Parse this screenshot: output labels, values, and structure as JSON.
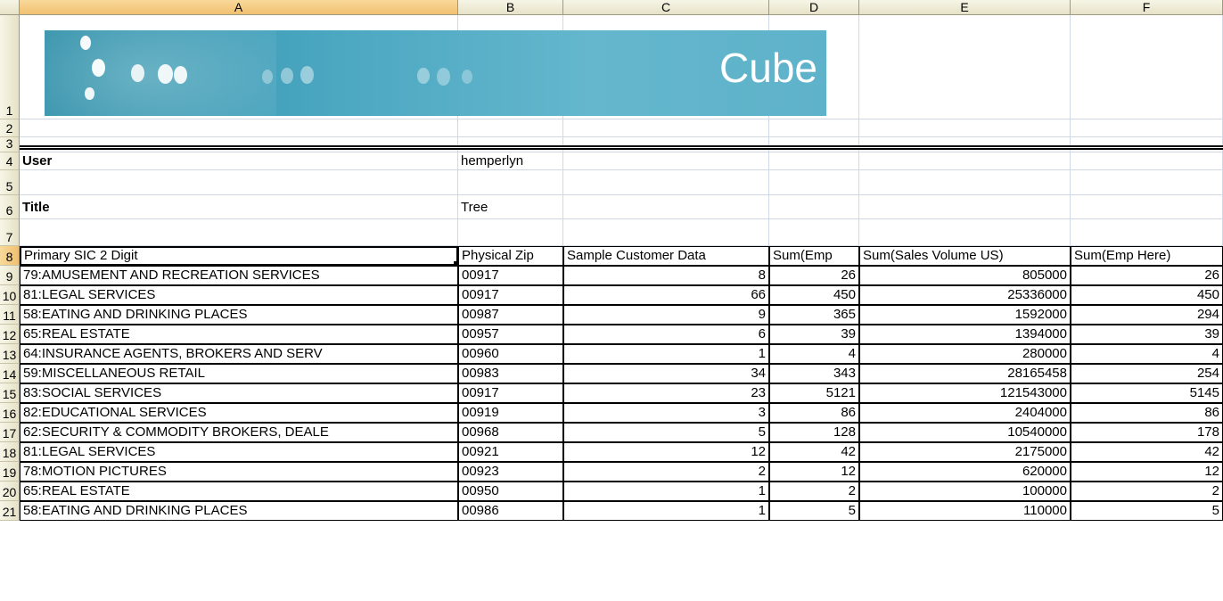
{
  "columns": [
    "A",
    "B",
    "C",
    "D",
    "E",
    "F"
  ],
  "row_numbers": [
    "1",
    "2",
    "3",
    "4",
    "5",
    "6",
    "7",
    "8",
    "9",
    "10",
    "11",
    "12",
    "13",
    "14",
    "15",
    "16",
    "17",
    "18",
    "19",
    "20",
    "21"
  ],
  "banner": {
    "title": "Cube"
  },
  "info": {
    "user_label": "User",
    "user_value": "hemperlyn",
    "title_label": "Title",
    "title_value": "Tree"
  },
  "table": {
    "headers": [
      "Primary SIC 2 Digit",
      "Physical Zip",
      "Sample Customer Data",
      "Sum(Emp",
      "Sum(Sales Volume US)",
      "Sum(Emp Here)"
    ],
    "rows": [
      [
        "79:AMUSEMENT AND RECREATION SERVICES",
        "00917",
        "8",
        "26",
        "805000",
        "26"
      ],
      [
        "81:LEGAL SERVICES",
        "00917",
        "66",
        "450",
        "25336000",
        "450"
      ],
      [
        "58:EATING AND DRINKING PLACES",
        "00987",
        "9",
        "365",
        "1592000",
        "294"
      ],
      [
        "65:REAL ESTATE",
        "00957",
        "6",
        "39",
        "1394000",
        "39"
      ],
      [
        "64:INSURANCE AGENTS, BROKERS AND SERV",
        "00960",
        "1",
        "4",
        "280000",
        "4"
      ],
      [
        "59:MISCELLANEOUS RETAIL",
        "00983",
        "34",
        "343",
        "28165458",
        "254"
      ],
      [
        "83:SOCIAL SERVICES",
        "00917",
        "23",
        "5121",
        "121543000",
        "5145"
      ],
      [
        "82:EDUCATIONAL SERVICES",
        "00919",
        "3",
        "86",
        "2404000",
        "86"
      ],
      [
        "62:SECURITY & COMMODITY BROKERS, DEALE",
        "00968",
        "5",
        "128",
        "10540000",
        "178"
      ],
      [
        "81:LEGAL SERVICES",
        "00921",
        "12",
        "42",
        "2175000",
        "42"
      ],
      [
        "78:MOTION PICTURES",
        "00923",
        "2",
        "12",
        "620000",
        "12"
      ],
      [
        "65:REAL ESTATE",
        "00950",
        "1",
        "2",
        "100000",
        "2"
      ],
      [
        "58:EATING AND DRINKING PLACES",
        "00986",
        "1",
        "5",
        "110000",
        "5"
      ]
    ]
  },
  "colors": {
    "banner_start": "#2d8fa8",
    "banner_end": "#5eb2c9",
    "header_selected": "#f0c070"
  }
}
